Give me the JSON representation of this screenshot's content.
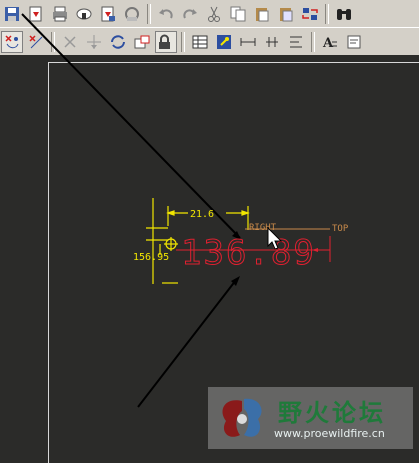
{
  "toolbar_row1": [
    {
      "icon": "save-icon"
    },
    {
      "icon": "pdf-export-icon"
    },
    {
      "icon": "print-icon"
    },
    {
      "icon": "network-print-icon"
    },
    {
      "icon": "pdf-icon"
    },
    {
      "icon": "email-icon"
    },
    {
      "icon": "undo-icon"
    },
    {
      "icon": "redo-icon"
    },
    {
      "icon": "cut-icon"
    },
    {
      "icon": "copy-icon"
    },
    {
      "icon": "paste-icon"
    },
    {
      "icon": "paste-special-icon"
    },
    {
      "icon": "regenerate-icon"
    },
    {
      "icon": "binoculars-icon"
    }
  ],
  "toolbar_row2": [
    {
      "icon": "select-x-icon",
      "pressed": true
    },
    {
      "icon": "select-y-icon"
    },
    {
      "icon": "delete-icon"
    },
    {
      "icon": "move-icon"
    },
    {
      "icon": "refresh-icon"
    },
    {
      "icon": "insert-view-icon"
    },
    {
      "icon": "locked-view-icon",
      "pressed": true
    },
    {
      "icon": "table-icon"
    },
    {
      "icon": "annotation-icon"
    },
    {
      "icon": "dimension-icon"
    },
    {
      "icon": "ordinate-dimension-icon"
    },
    {
      "icon": "align-icon"
    },
    {
      "icon": "text-style-icon"
    },
    {
      "icon": "note-icon"
    }
  ],
  "drawing": {
    "dim_top": "21.6",
    "dim_left": "156.95",
    "dim_big": "136.89",
    "label_right": "RIGHT",
    "label_top": "TOP"
  },
  "watermark": {
    "title": "野火论坛",
    "url": "www.proewildfire.cn"
  },
  "colors": {
    "background": "#2b2b29",
    "toolbar": "#d4d0c8",
    "dimension_yellow": "#f2e600",
    "selected_red": "#e02030",
    "datum_orange": "#c88a4a"
  }
}
